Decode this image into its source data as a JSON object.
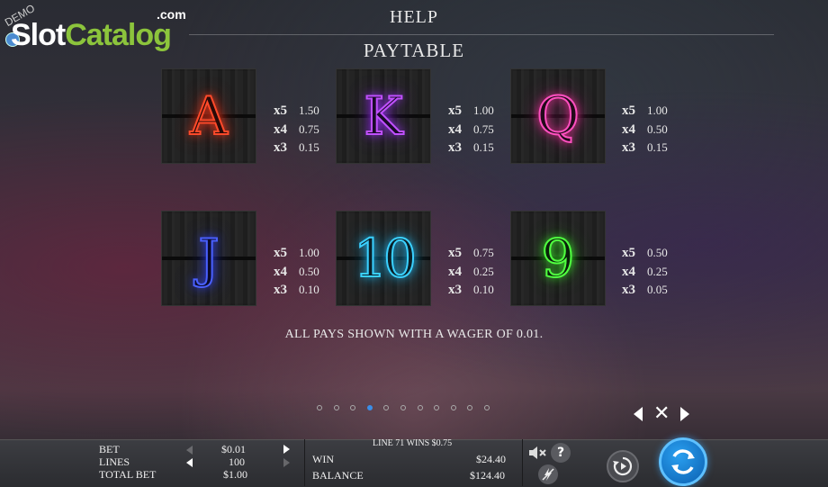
{
  "logo": {
    "demo": "DEMO",
    "slot": "Slot",
    "catalog": "Catalog",
    "com": ".com"
  },
  "header": {
    "help": "HELP",
    "paytable": "PAYTABLE"
  },
  "symbols": [
    {
      "name": "A",
      "pays": [
        {
          "m": "x5",
          "v": "1.50"
        },
        {
          "m": "x4",
          "v": "0.75"
        },
        {
          "m": "x3",
          "v": "0.15"
        }
      ]
    },
    {
      "name": "K",
      "pays": [
        {
          "m": "x5",
          "v": "1.00"
        },
        {
          "m": "x4",
          "v": "0.75"
        },
        {
          "m": "x3",
          "v": "0.15"
        }
      ]
    },
    {
      "name": "Q",
      "pays": [
        {
          "m": "x5",
          "v": "1.00"
        },
        {
          "m": "x4",
          "v": "0.50"
        },
        {
          "m": "x3",
          "v": "0.15"
        }
      ]
    },
    {
      "name": "J",
      "pays": [
        {
          "m": "x5",
          "v": "1.00"
        },
        {
          "m": "x4",
          "v": "0.50"
        },
        {
          "m": "x3",
          "v": "0.10"
        }
      ]
    },
    {
      "name": "10",
      "pays": [
        {
          "m": "x5",
          "v": "0.75"
        },
        {
          "m": "x4",
          "v": "0.25"
        },
        {
          "m": "x3",
          "v": "0.10"
        }
      ]
    },
    {
      "name": "9",
      "pays": [
        {
          "m": "x5",
          "v": "0.50"
        },
        {
          "m": "x4",
          "v": "0.25"
        },
        {
          "m": "x3",
          "v": "0.05"
        }
      ]
    }
  ],
  "note": "ALL PAYS SHOWN WITH A WAGER OF 0.01.",
  "pagination": {
    "total": 11,
    "active": 3
  },
  "nav": {
    "close": "✕"
  },
  "bottom": {
    "bet_label": "BET",
    "bet_value": "$0.01",
    "lines_label": "LINES",
    "lines_value": "100",
    "total_bet_label": "TOTAL BET",
    "total_bet_value": "$1.00",
    "line_win": "LINE 71 WINS $0.75",
    "win_label": "WIN",
    "win_value": "$24.40",
    "balance_label": "BALANCE",
    "balance_value": "$124.40",
    "help": "?"
  },
  "icons": [
    "mute-speaker-icon",
    "help-icon",
    "turbo-icon",
    "autoplay-icon",
    "spin-icon",
    "arrow-left-icon",
    "arrow-right-icon",
    "close-icon"
  ],
  "colors": {
    "spin": "#1a7fd6",
    "active_dot": "#3a8ee8",
    "logo_green": "#8cc43c"
  }
}
